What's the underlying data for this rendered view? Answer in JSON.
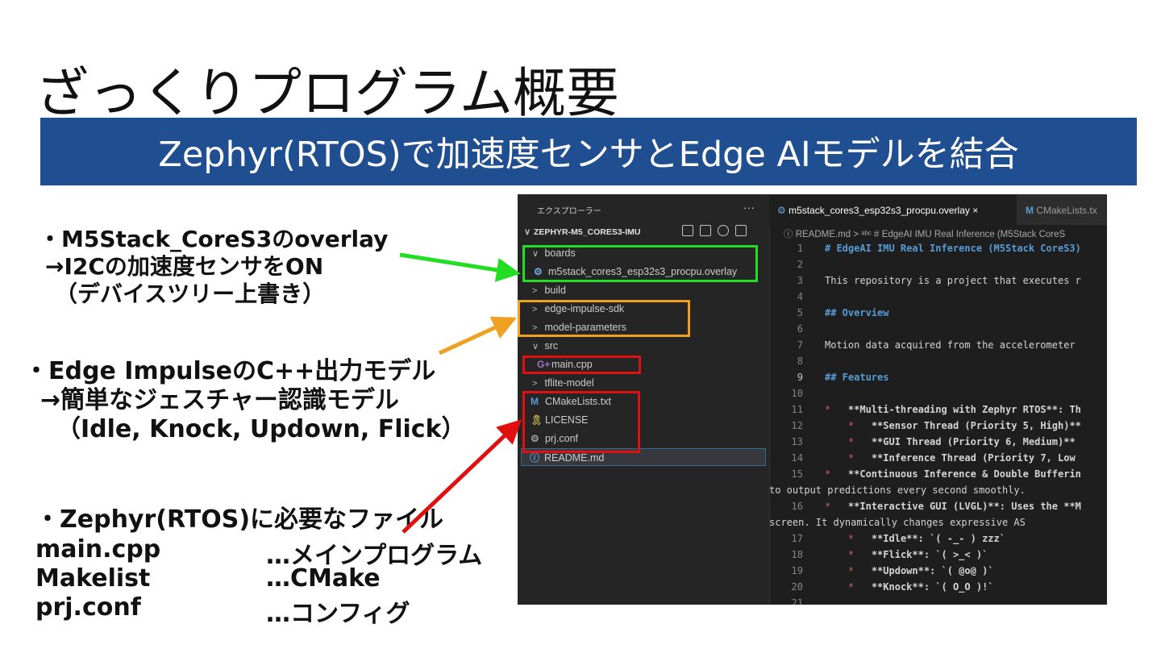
{
  "slide": {
    "title": "ざっくりプログラム概要",
    "banner": "Zephyr(RTOS)で加速度センサとEdge AIモデルを結合"
  },
  "left_notes": {
    "overlay_1": "・M5Stack_CoreS3のoverlay",
    "overlay_2": "→I2Cの加速度センサをON",
    "overlay_3": "（デバイスツリー上書き）",
    "edge_1": "・Edge ImpulseのC++出力モデル",
    "edge_2": "→簡単なジェスチャー認識モデル",
    "edge_3": "（Idle, Knock, Updown, Flick）",
    "zephyr_title": "・Zephyr(RTOS)に必要なファイル",
    "files": [
      {
        "name": "main.cpp",
        "desc": "…メインプログラム"
      },
      {
        "name": "Makelist",
        "desc": "…CMake"
      },
      {
        "name": "prj.conf",
        "desc": "…コンフィグ"
      }
    ]
  },
  "vscode": {
    "explorer_title": "エクスプローラー",
    "more": "···",
    "root": "ZEPHYR-M5_CORES3-IMU",
    "tree": [
      {
        "chevron": "∨",
        "icon": "",
        "label": "boards"
      },
      {
        "chevron": "",
        "icon": "⚙",
        "label": "m5stack_cores3_esp32s3_procpu.overlay"
      },
      {
        "chevron": ">",
        "icon": "",
        "label": "build"
      },
      {
        "chevron": ">",
        "icon": "",
        "label": "edge-impulse-sdk"
      },
      {
        "chevron": ">",
        "icon": "",
        "label": "model-parameters"
      },
      {
        "chevron": "∨",
        "icon": "",
        "label": "src"
      },
      {
        "chevron": "",
        "icon": "G+",
        "label": "main.cpp"
      },
      {
        "chevron": ">",
        "icon": "",
        "label": "tflite-model"
      },
      {
        "chevron": "",
        "icon": "M",
        "label": "CMakeLists.txt"
      },
      {
        "chevron": "",
        "icon": "🎗",
        "label": "LICENSE"
      },
      {
        "chevron": "",
        "icon": "⚙",
        "label": "prj.conf"
      },
      {
        "chevron": "",
        "icon": "ⓘ",
        "label": "README.md"
      }
    ],
    "tab_active": "m5stack_cores3_esp32s3_procpu.overlay",
    "tab_close": "×",
    "tab_second": "CMakeLists.tx",
    "breadcrumb": "ⓘ README.md > ᵃᵇᶜ # EdgeAI IMU Real Inference (M5Stack CoreS",
    "code_lines": [
      {
        "n": "1",
        "t": "# EdgeAI IMU Real Inference (M5Stack CoreS3)"
      },
      {
        "n": "2",
        "t": ""
      },
      {
        "n": "3",
        "t": "This repository is a project that executes r"
      },
      {
        "n": "4",
        "t": ""
      },
      {
        "n": "5",
        "t": "## Overview"
      },
      {
        "n": "6",
        "t": ""
      },
      {
        "n": "7",
        "t": "Motion data acquired from the accelerometer"
      },
      {
        "n": "8",
        "t": ""
      },
      {
        "n": "9",
        "t": "## Features"
      },
      {
        "n": "10",
        "t": ""
      },
      {
        "n": "11",
        "t": "*   **Multi-threading with Zephyr RTOS**: Th"
      },
      {
        "n": "12",
        "t": "    *   **Sensor Thread (Priority 5, High)**"
      },
      {
        "n": "13",
        "t": "    *   **GUI Thread (Priority 6, Medium)**"
      },
      {
        "n": "14",
        "t": "    *   **Inference Thread (Priority 7, Low"
      },
      {
        "n": "15",
        "t": "*   **Continuous Inference & Double Bufferin"
      },
      {
        "n": "",
        "t": "to output predictions every second smoothly."
      },
      {
        "n": "16",
        "t": "*   **Interactive GUI (LVGL)**: Uses the **M"
      },
      {
        "n": "",
        "t": "screen. It dynamically changes expressive AS"
      },
      {
        "n": "17",
        "t": "    *   **Idle**: `( -_- ) zzz`"
      },
      {
        "n": "18",
        "t": "    *   **Flick**: `( >_< )`"
      },
      {
        "n": "19",
        "t": "    *   **Updown**: `( @o@ )`"
      },
      {
        "n": "20",
        "t": "    *   **Knock**: `( O_O )!`"
      },
      {
        "n": "21",
        "t": ""
      }
    ]
  },
  "colors": {
    "banner": "#1f4e91",
    "green": "#22dd22",
    "orange": "#f0a020",
    "red": "#e01010"
  }
}
